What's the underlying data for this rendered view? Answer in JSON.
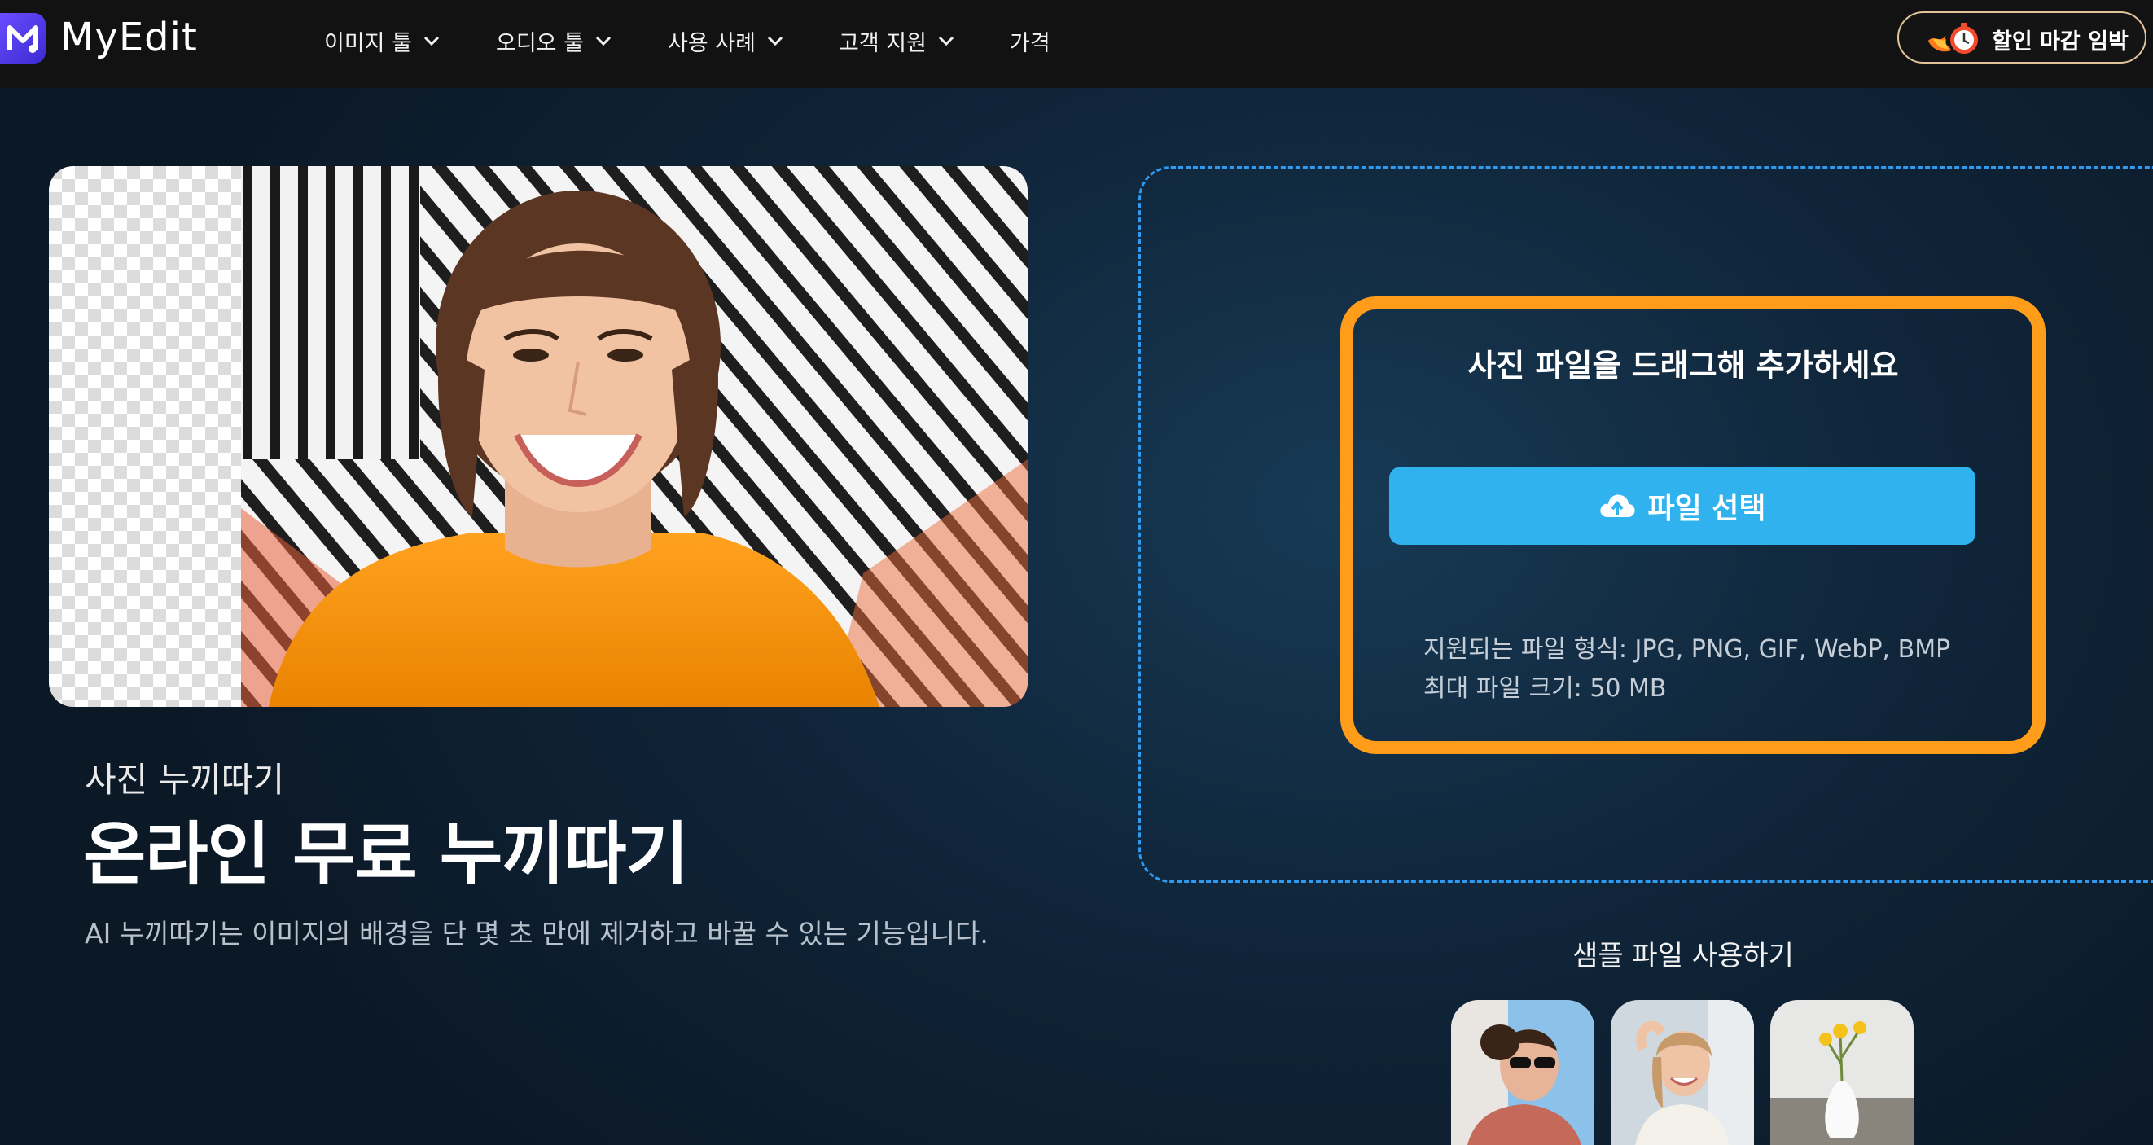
{
  "brand": {
    "name": "MyEdit"
  },
  "nav": {
    "items": [
      {
        "label": "이미지 툴",
        "has_dropdown": true
      },
      {
        "label": "오디오 툴",
        "has_dropdown": true
      },
      {
        "label": "사용 사례",
        "has_dropdown": true
      },
      {
        "label": "고객 지원",
        "has_dropdown": true
      },
      {
        "label": "가격",
        "has_dropdown": false
      }
    ],
    "promo_label": "할인 마감 임박"
  },
  "hero": {
    "tool_name": "사진 누끼따기",
    "headline": "온라인 무료 누끼따기",
    "description": "AI 누끼따기는 이미지의 배경을 단 몇 초 만에 제거하고 바꿀 수 있는 기능입니다."
  },
  "upload": {
    "drop_title": "사진 파일을 드래그해 추가하세요",
    "button_label": "파일 선택",
    "supported_formats": "지원되는 파일 형식: JPG, PNG, GIF, WebP, BMP",
    "max_size": "최대 파일 크기: 50 MB"
  },
  "samples": {
    "title": "샘플 파일 사용하기",
    "items": [
      "sample-woman-sunglasses",
      "sample-woman-smiling",
      "sample-vase-flowers"
    ]
  },
  "colors": {
    "nav_bg": "#121212",
    "accent_blue": "#2fb2ee",
    "dashed_border": "#2f9bf0",
    "highlight_orange": "#ff9d1b",
    "brand_purple": "#5b3ff0"
  },
  "icons": [
    "logo-icon",
    "chevron-down-icon",
    "timer-fire-icon",
    "cloud-upload-icon"
  ]
}
